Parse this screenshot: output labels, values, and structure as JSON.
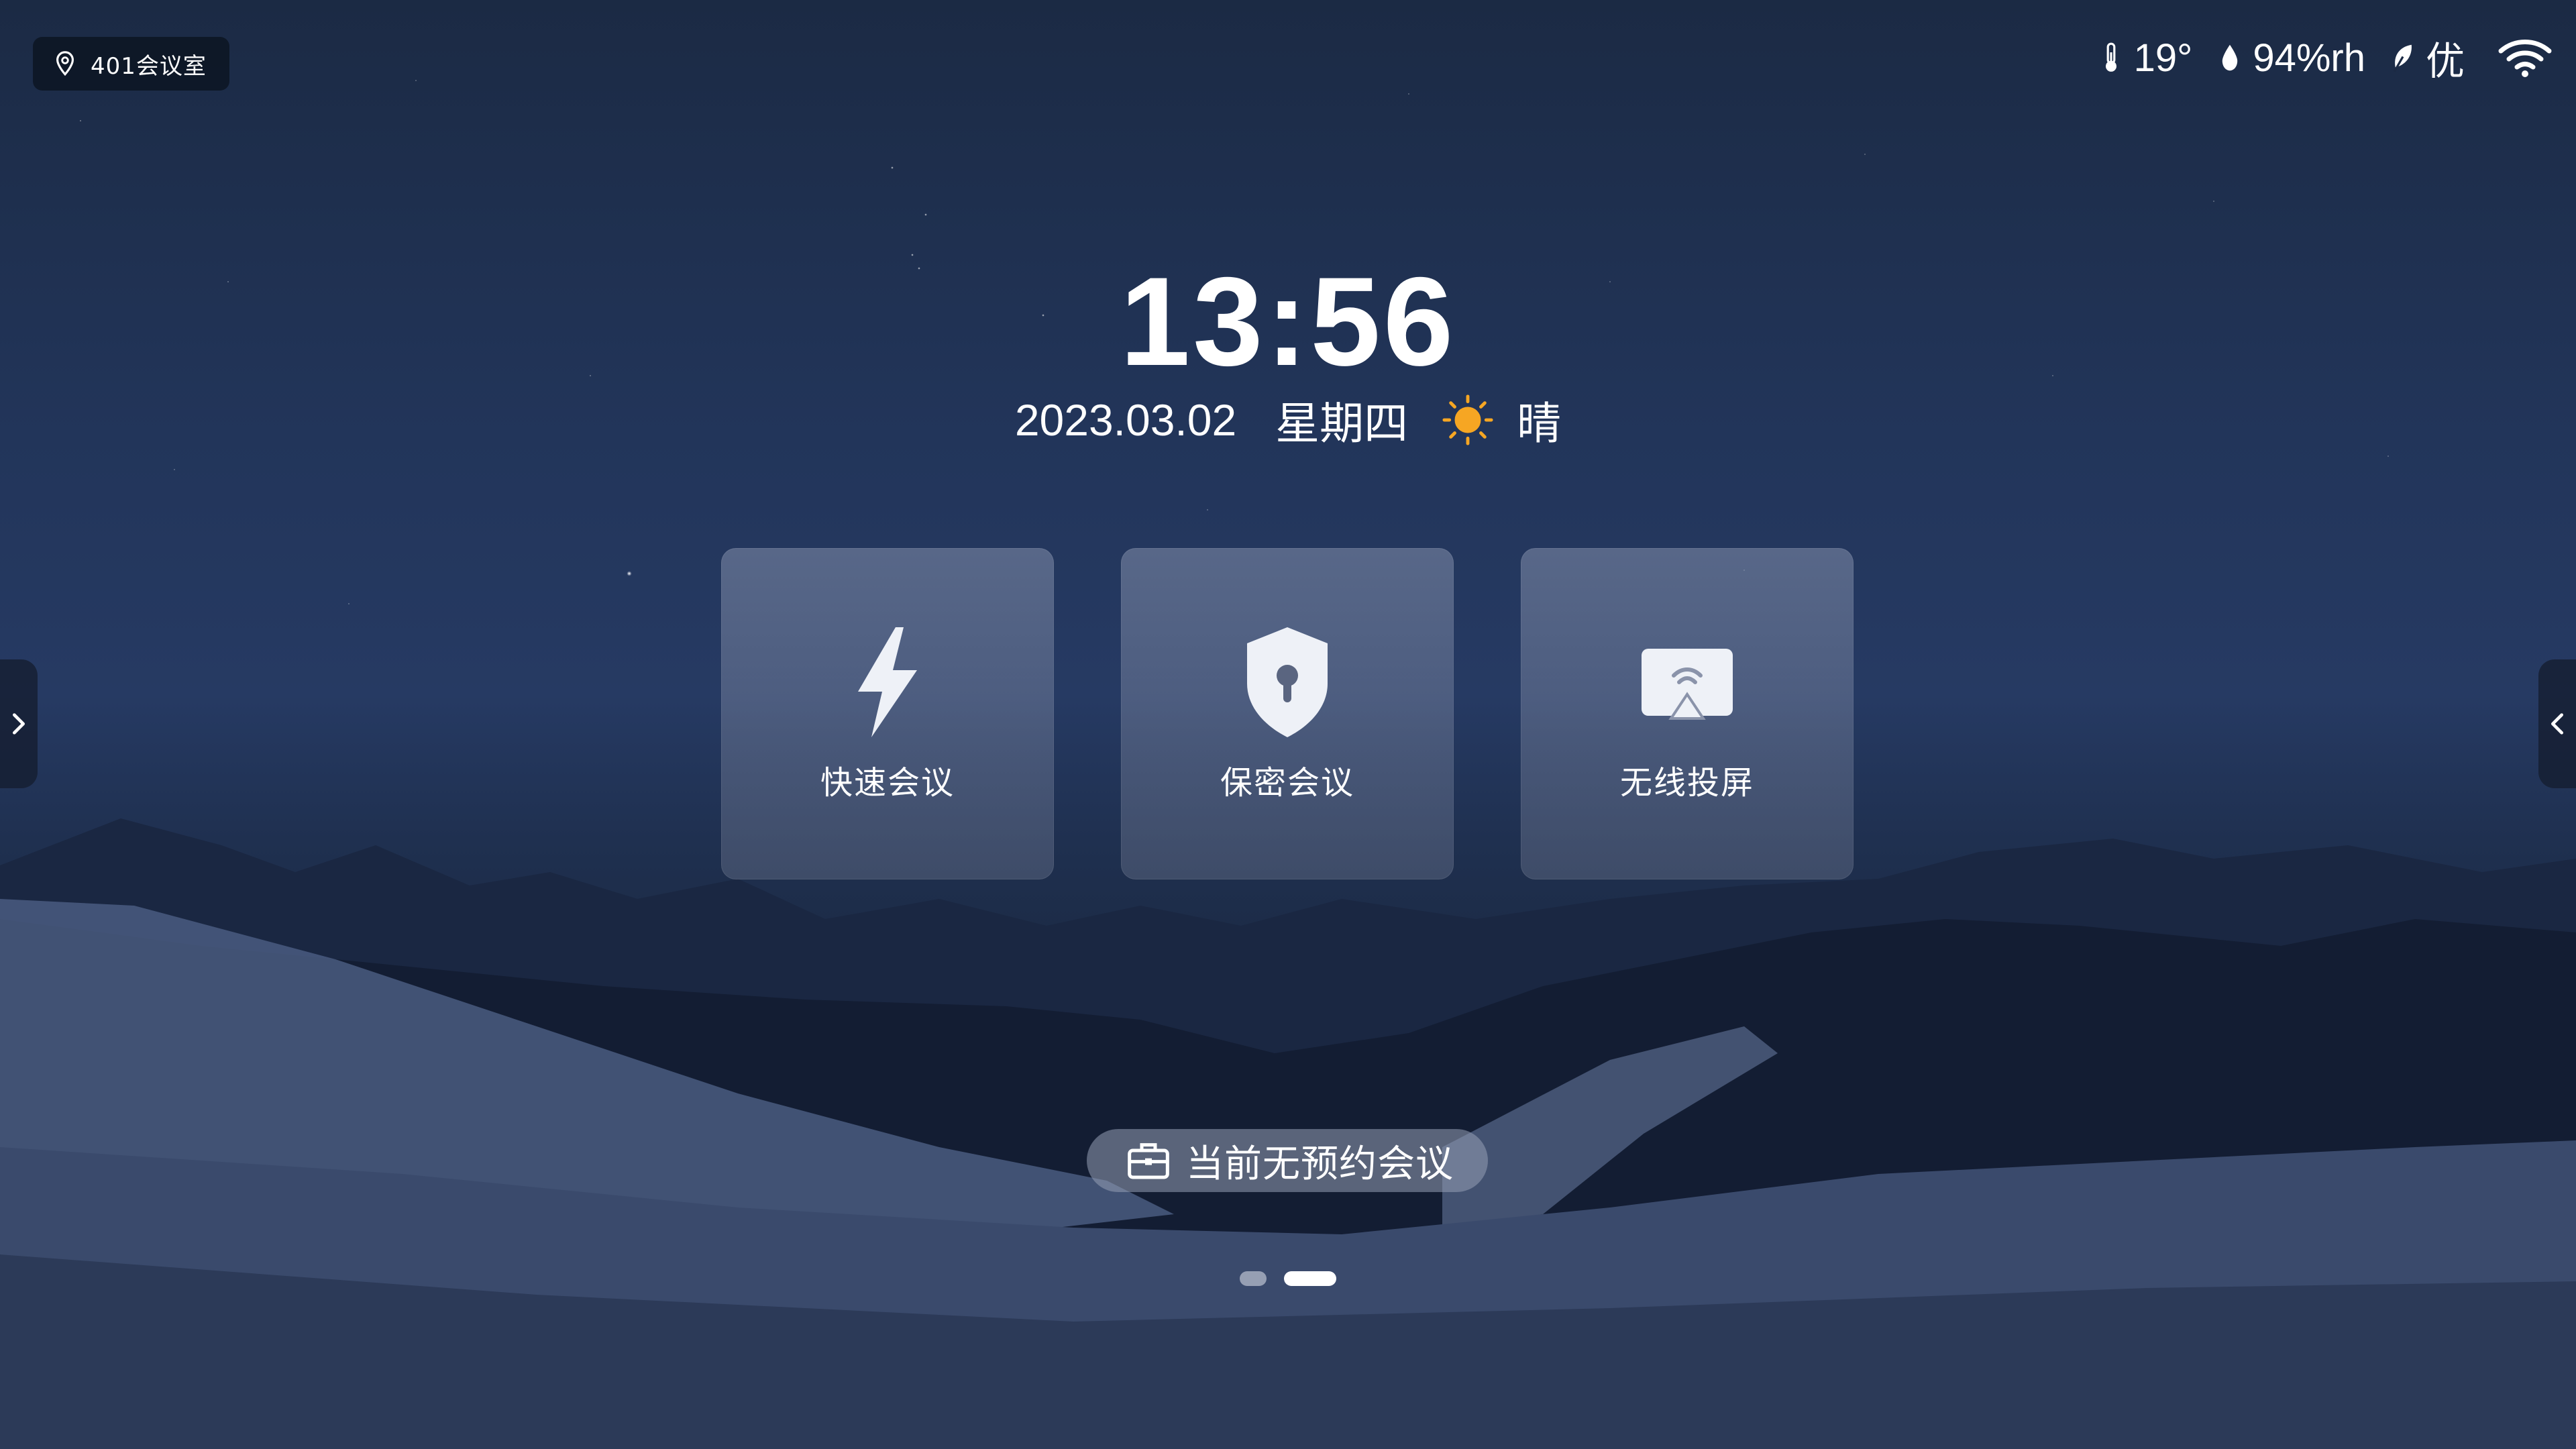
{
  "location": {
    "room": "401会议室",
    "icon": "location-pin-icon"
  },
  "status": {
    "temperature": "19°",
    "humidity": "94%rh",
    "air_quality": "优",
    "icons": [
      "thermometer-icon",
      "humidity-drop-icon",
      "leaf-icon",
      "wifi-icon"
    ]
  },
  "clock": {
    "time": "13:56",
    "date": "2023.03.02",
    "weekday": "星期四",
    "weather": "晴",
    "weather_icon": "sun-icon"
  },
  "cards": [
    {
      "label": "快速会议",
      "icon": "lightning-icon"
    },
    {
      "label": "保密会议",
      "icon": "shield-lock-icon"
    },
    {
      "label": "无线投屏",
      "icon": "wireless-cast-icon"
    }
  ],
  "meeting": {
    "text": "当前无预约会议",
    "icon": "briefcase-icon"
  },
  "pagination": {
    "total": 2,
    "active_index": 1
  },
  "colors": {
    "sun": "#f6a623",
    "card_bg": "#8c95ad",
    "overlay": "#0a101c"
  }
}
